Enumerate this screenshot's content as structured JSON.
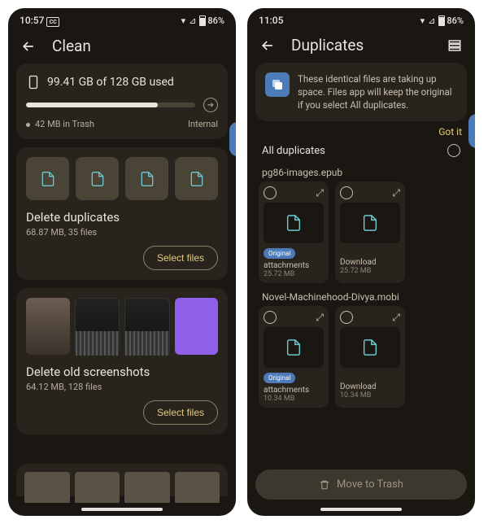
{
  "screen1": {
    "status": {
      "time": "10:57",
      "battery": "86%"
    },
    "title": "Clean",
    "storage": {
      "used_text": "99.41 GB of 128 GB used",
      "trash": "42 MB in Trash",
      "location": "Internal",
      "percent": 78
    },
    "duplicates": {
      "heading": "Delete duplicates",
      "subtitle": "68.87 MB, 35 files",
      "button": "Select files"
    },
    "screenshots": {
      "heading": "Delete old screenshots",
      "subtitle": "64.12 MB, 128 files",
      "button": "Select files"
    }
  },
  "screen2": {
    "status": {
      "time": "11:05",
      "battery": "86%"
    },
    "title": "Duplicates",
    "banner": {
      "text": "These identical files are taking up space. Files app will keep the original if you select All duplicates.",
      "action": "Got it"
    },
    "all_label": "All duplicates",
    "groups": [
      {
        "name": "pg86-images.epub",
        "items": [
          {
            "folder": "attachments",
            "size": "25.72 MB",
            "original": true
          },
          {
            "folder": "Download",
            "size": "25.72 MB",
            "original": false
          }
        ]
      },
      {
        "name": "Novel-Machinehood-Divya.mobi",
        "items": [
          {
            "folder": "attachments",
            "size": "10.34 MB",
            "original": true
          },
          {
            "folder": "Download",
            "size": "10.34 MB",
            "original": false
          }
        ]
      }
    ],
    "bottom_action": "Move to Trash"
  }
}
